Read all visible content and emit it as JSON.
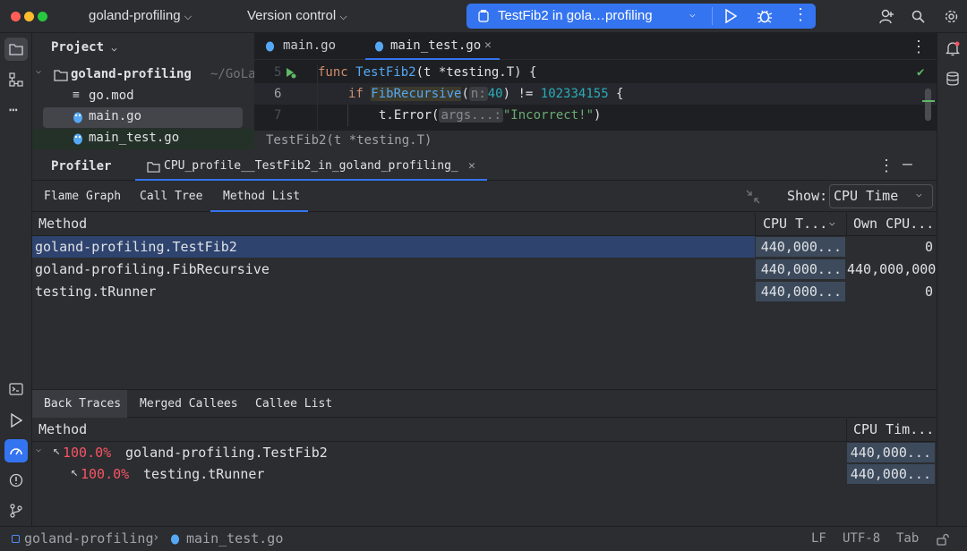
{
  "titlebar": {
    "project": "goland-profiling",
    "vcs": "Version control",
    "run_config": "TestFib2 in gola…profiling"
  },
  "project_panel": {
    "title": "Project",
    "root": "goland-profiling",
    "root_path": "~/GoLa",
    "files": [
      "go.mod",
      "main.go",
      "main_test.go"
    ]
  },
  "editor": {
    "tabs": [
      "main.go",
      "main_test.go"
    ],
    "line_numbers": [
      "5",
      "6",
      "7"
    ],
    "line5": {
      "kw": "func",
      "name": "TestFib2",
      "rest": "(t *testing.T) {"
    },
    "line6": {
      "kw": "if",
      "call": "FibRecursive",
      "paren": "(",
      "hint": "n:",
      "arg": "40",
      "rest": ") != ",
      "num": "102334155",
      "end": " {"
    },
    "line7": {
      "call": "t.Error(",
      "hint": "args...:",
      "str": "\"Incorrect!\"",
      "end": ")"
    },
    "breadcrumb": "TestFib2(t *testing.T)"
  },
  "profiler": {
    "title": "Profiler",
    "tab": "CPU_profile__TestFib2_in_goland_profiling_",
    "views": [
      "Flame Graph",
      "Call Tree",
      "Method List"
    ],
    "show_label": "Show:",
    "show_value": "CPU Time",
    "columns": {
      "method": "Method",
      "cpu": "CPU T...",
      "own": "Own CPU..."
    },
    "rows": [
      {
        "method": "goland-profiling.TestFib2",
        "cpu": "440,000...",
        "own": "0"
      },
      {
        "method": "goland-profiling.FibRecursive",
        "cpu": "440,000...",
        "own": "440,000,000"
      },
      {
        "method": "testing.tRunner",
        "cpu": "440,000...",
        "own": "0"
      }
    ],
    "bottom_tabs": [
      "Back Traces",
      "Merged Callees",
      "Callee List"
    ],
    "bottom_columns": {
      "method": "Method",
      "cpu": "CPU Tim..."
    },
    "bottom_rows": [
      {
        "pct": "100.0%",
        "method": "goland-profiling.TestFib2",
        "cpu": "440,000..."
      },
      {
        "pct": "100.0%",
        "method": "testing.tRunner",
        "cpu": "440,000..."
      }
    ]
  },
  "statusbar": {
    "project": "goland-profiling",
    "file": "main_test.go",
    "line_sep": "LF",
    "encoding": "UTF-8",
    "indent": "Tab"
  },
  "colors": {
    "accent": "#3574f0",
    "selection": "#2e436e",
    "keyword": "#cf8e6d",
    "function": "#56a8f5",
    "number": "#2aacb8",
    "string": "#6aab73"
  }
}
